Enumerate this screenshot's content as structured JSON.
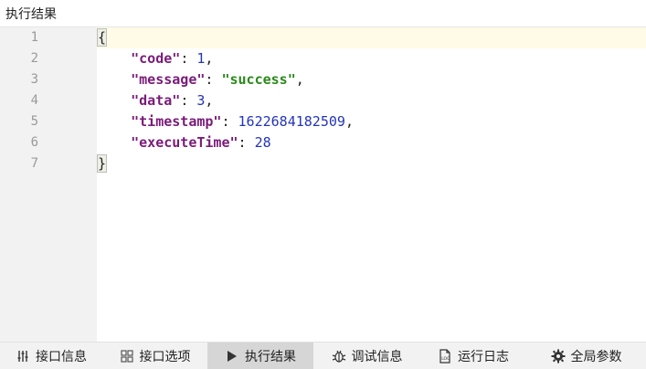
{
  "panel": {
    "title": "执行结果"
  },
  "editor": {
    "line_numbers": [
      "1",
      "2",
      "3",
      "4",
      "5",
      "6",
      "7"
    ],
    "lines": [
      {
        "segments": [
          {
            "cls": "brace",
            "text": "{"
          }
        ]
      },
      {
        "segments": [
          {
            "cls": "punct",
            "text": "    "
          },
          {
            "cls": "key",
            "text": "\"code\""
          },
          {
            "cls": "punct",
            "text": ": "
          },
          {
            "cls": "num",
            "text": "1"
          },
          {
            "cls": "punct",
            "text": ","
          }
        ]
      },
      {
        "segments": [
          {
            "cls": "punct",
            "text": "    "
          },
          {
            "cls": "key",
            "text": "\"message\""
          },
          {
            "cls": "punct",
            "text": ": "
          },
          {
            "cls": "str",
            "text": "\"success\""
          },
          {
            "cls": "punct",
            "text": ","
          }
        ]
      },
      {
        "segments": [
          {
            "cls": "punct",
            "text": "    "
          },
          {
            "cls": "key",
            "text": "\"data\""
          },
          {
            "cls": "punct",
            "text": ": "
          },
          {
            "cls": "num",
            "text": "3"
          },
          {
            "cls": "punct",
            "text": ","
          }
        ]
      },
      {
        "segments": [
          {
            "cls": "punct",
            "text": "    "
          },
          {
            "cls": "key",
            "text": "\"timestamp\""
          },
          {
            "cls": "punct",
            "text": ": "
          },
          {
            "cls": "num",
            "text": "1622684182509"
          },
          {
            "cls": "punct",
            "text": ","
          }
        ]
      },
      {
        "segments": [
          {
            "cls": "punct",
            "text": "    "
          },
          {
            "cls": "key",
            "text": "\"executeTime\""
          },
          {
            "cls": "punct",
            "text": ": "
          },
          {
            "cls": "num",
            "text": "28"
          }
        ]
      },
      {
        "segments": [
          {
            "cls": "brace",
            "text": "}"
          }
        ]
      }
    ]
  },
  "tabs": [
    {
      "label": "接口信息",
      "icon": "sliders-icon",
      "active": false
    },
    {
      "label": "接口选项",
      "icon": "grid-icon",
      "active": false
    },
    {
      "label": "执行结果",
      "icon": "play-icon",
      "active": true
    },
    {
      "label": "调试信息",
      "icon": "bug-icon",
      "active": false
    },
    {
      "label": "运行日志",
      "icon": "log-file-icon",
      "active": false
    },
    {
      "label": "全局参数",
      "icon": "gear-icon",
      "active": false
    }
  ],
  "colors": {
    "key": "#7a1b7a",
    "string": "#2a8a1a",
    "number": "#2434b8",
    "active_line": "#fffbe6",
    "gutter": "#f2f2f2"
  }
}
